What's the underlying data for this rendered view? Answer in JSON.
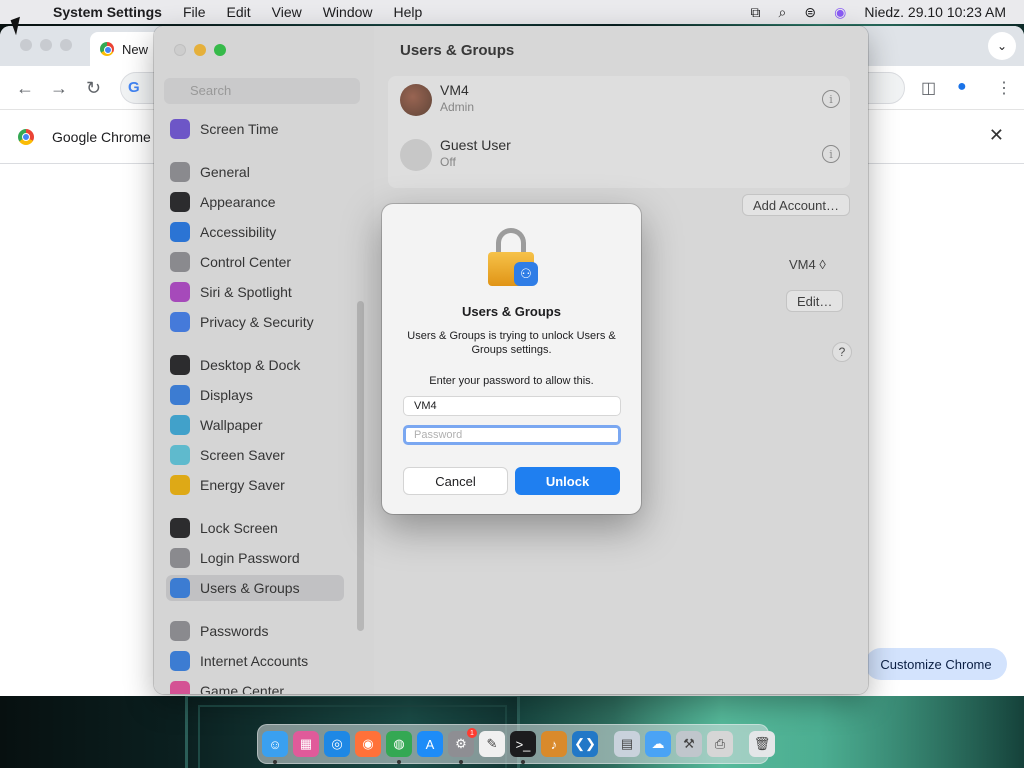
{
  "menubar": {
    "app_name": "System Settings",
    "menus": [
      "File",
      "Edit",
      "View",
      "Window",
      "Help"
    ],
    "datetime": "Niedz. 29.10  10:23 AM"
  },
  "chrome": {
    "tab_title": "New",
    "info_text": "Google Chrome i",
    "customize_label": "Customize Chrome",
    "omnibox_letter": "G"
  },
  "settings": {
    "title": "Users & Groups",
    "search_placeholder": "Search",
    "sidebar": [
      {
        "label": "Screen Time",
        "icon": "screen-time-icon",
        "color": "#6b4fd8"
      },
      {
        "label": "General",
        "icon": "gear-icon",
        "color": "#8e8e93"
      },
      {
        "label": "Appearance",
        "icon": "appearance-icon",
        "color": "#1c1c1e"
      },
      {
        "label": "Accessibility",
        "icon": "accessibility-icon",
        "color": "#1a73e8"
      },
      {
        "label": "Control Center",
        "icon": "control-center-icon",
        "color": "#8e8e93"
      },
      {
        "label": "Siri & Spotlight",
        "icon": "siri-icon",
        "color": "#b040c8"
      },
      {
        "label": "Privacy & Security",
        "icon": "hand-icon",
        "color": "#3a7bf0"
      },
      {
        "label": "Desktop & Dock",
        "icon": "dock-icon",
        "color": "#1c1c1e"
      },
      {
        "label": "Displays",
        "icon": "sun-icon",
        "color": "#2f7de6"
      },
      {
        "label": "Wallpaper",
        "icon": "wallpaper-icon",
        "color": "#35aadc"
      },
      {
        "label": "Screen Saver",
        "icon": "screen-saver-icon",
        "color": "#5ac8e0"
      },
      {
        "label": "Energy Saver",
        "icon": "bulb-icon",
        "color": "#f5b400"
      },
      {
        "label": "Lock Screen",
        "icon": "lock-screen-icon",
        "color": "#1c1c1e"
      },
      {
        "label": "Login Password",
        "icon": "lock-icon",
        "color": "#8e8e93"
      },
      {
        "label": "Users & Groups",
        "icon": "users-icon",
        "color": "#2f7de6"
      },
      {
        "label": "Passwords",
        "icon": "key-icon",
        "color": "#8e8e93"
      },
      {
        "label": "Internet Accounts",
        "icon": "at-icon",
        "color": "#2f7de6"
      },
      {
        "label": "Game Center",
        "icon": "game-center-icon",
        "color": "#e84a9a"
      }
    ],
    "users": [
      {
        "name": "VM4",
        "role": "Admin"
      },
      {
        "name": "Guest User",
        "role": "Off"
      }
    ],
    "add_account_label": "Add Account…",
    "auto_login_value": "VM4 ◊",
    "edit_label": "Edit…",
    "help_label": "?"
  },
  "dialog": {
    "title": "Users & Groups",
    "message": "Users & Groups is trying to unlock Users & Groups settings.",
    "prompt": "Enter your password to allow this.",
    "username_value": "VM4",
    "password_placeholder": "Password",
    "cancel_label": "Cancel",
    "unlock_label": "Unlock"
  },
  "dock": [
    {
      "name": "finder-icon",
      "color": "#3aa0f0",
      "glyph": "☺",
      "running": true
    },
    {
      "name": "launchpad-icon",
      "color": "#e05a9a",
      "glyph": "▦",
      "running": false
    },
    {
      "name": "safari-icon",
      "color": "#1e88e5",
      "glyph": "◎",
      "running": false
    },
    {
      "name": "firefox-icon",
      "color": "#ff7139",
      "glyph": "◉",
      "running": false
    },
    {
      "name": "chrome-icon",
      "color": "#34a853",
      "glyph": "◍",
      "running": true
    },
    {
      "name": "app-store-icon",
      "color": "#1d8cf8",
      "glyph": "A",
      "running": false
    },
    {
      "name": "system-settings-icon",
      "color": "#8e8e93",
      "glyph": "⚙",
      "running": true,
      "badge": "1"
    },
    {
      "name": "textedit-icon",
      "color": "#f0f0f0",
      "glyph": "✎",
      "running": false
    },
    {
      "name": "terminal-icon",
      "color": "#1c1c1e",
      "glyph": ">_",
      "running": true
    },
    {
      "name": "instruments-icon",
      "color": "#d98a2b",
      "glyph": "♪",
      "running": false
    },
    {
      "name": "vscode-icon",
      "color": "#2278c7",
      "glyph": "❮❯",
      "running": false
    },
    {
      "name": "preview-icon",
      "color": "#c9d2dc",
      "glyph": "▤",
      "running": false
    },
    {
      "name": "finder-folder-icon",
      "color": "#4aa3f5",
      "glyph": "☁",
      "running": false
    },
    {
      "name": "utility-icon",
      "color": "#c0c6cc",
      "glyph": "⚒",
      "running": false
    },
    {
      "name": "printer-icon",
      "color": "#d6d6d6",
      "glyph": "⎙",
      "running": false
    },
    {
      "name": "trash-icon",
      "color": "#e4e6e8",
      "glyph": "🗑",
      "running": false
    }
  ]
}
